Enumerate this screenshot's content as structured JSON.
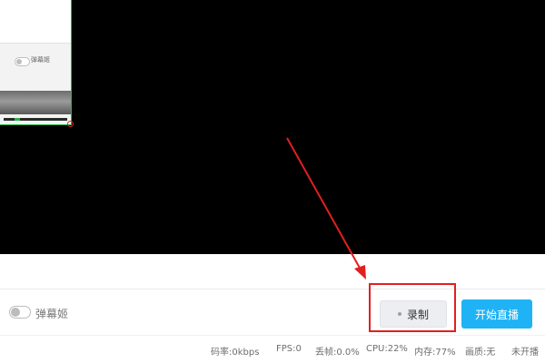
{
  "preview": {
    "thumbnail": {
      "danmu_label": "弹幕姬"
    }
  },
  "controls": {
    "danmu_label": "弹幕姬",
    "record_label": "录制",
    "start_live_label": "开始直播"
  },
  "status_bar": {
    "bitrate": "码率:0kbps",
    "fps": "FPS:0",
    "drop_rate": "丢帧:0.0%",
    "cpu": "CPU:22%",
    "memory": "内存:77%",
    "quality": "画质:无",
    "live_state": "未开播"
  },
  "colors": {
    "highlight": "#e21f1f",
    "primary": "#1fb3f5",
    "thumbnail_border": "#1fb84a"
  },
  "icons": {
    "record_indicator": "record-dot-icon",
    "annotation": "red-arrow-icon"
  }
}
